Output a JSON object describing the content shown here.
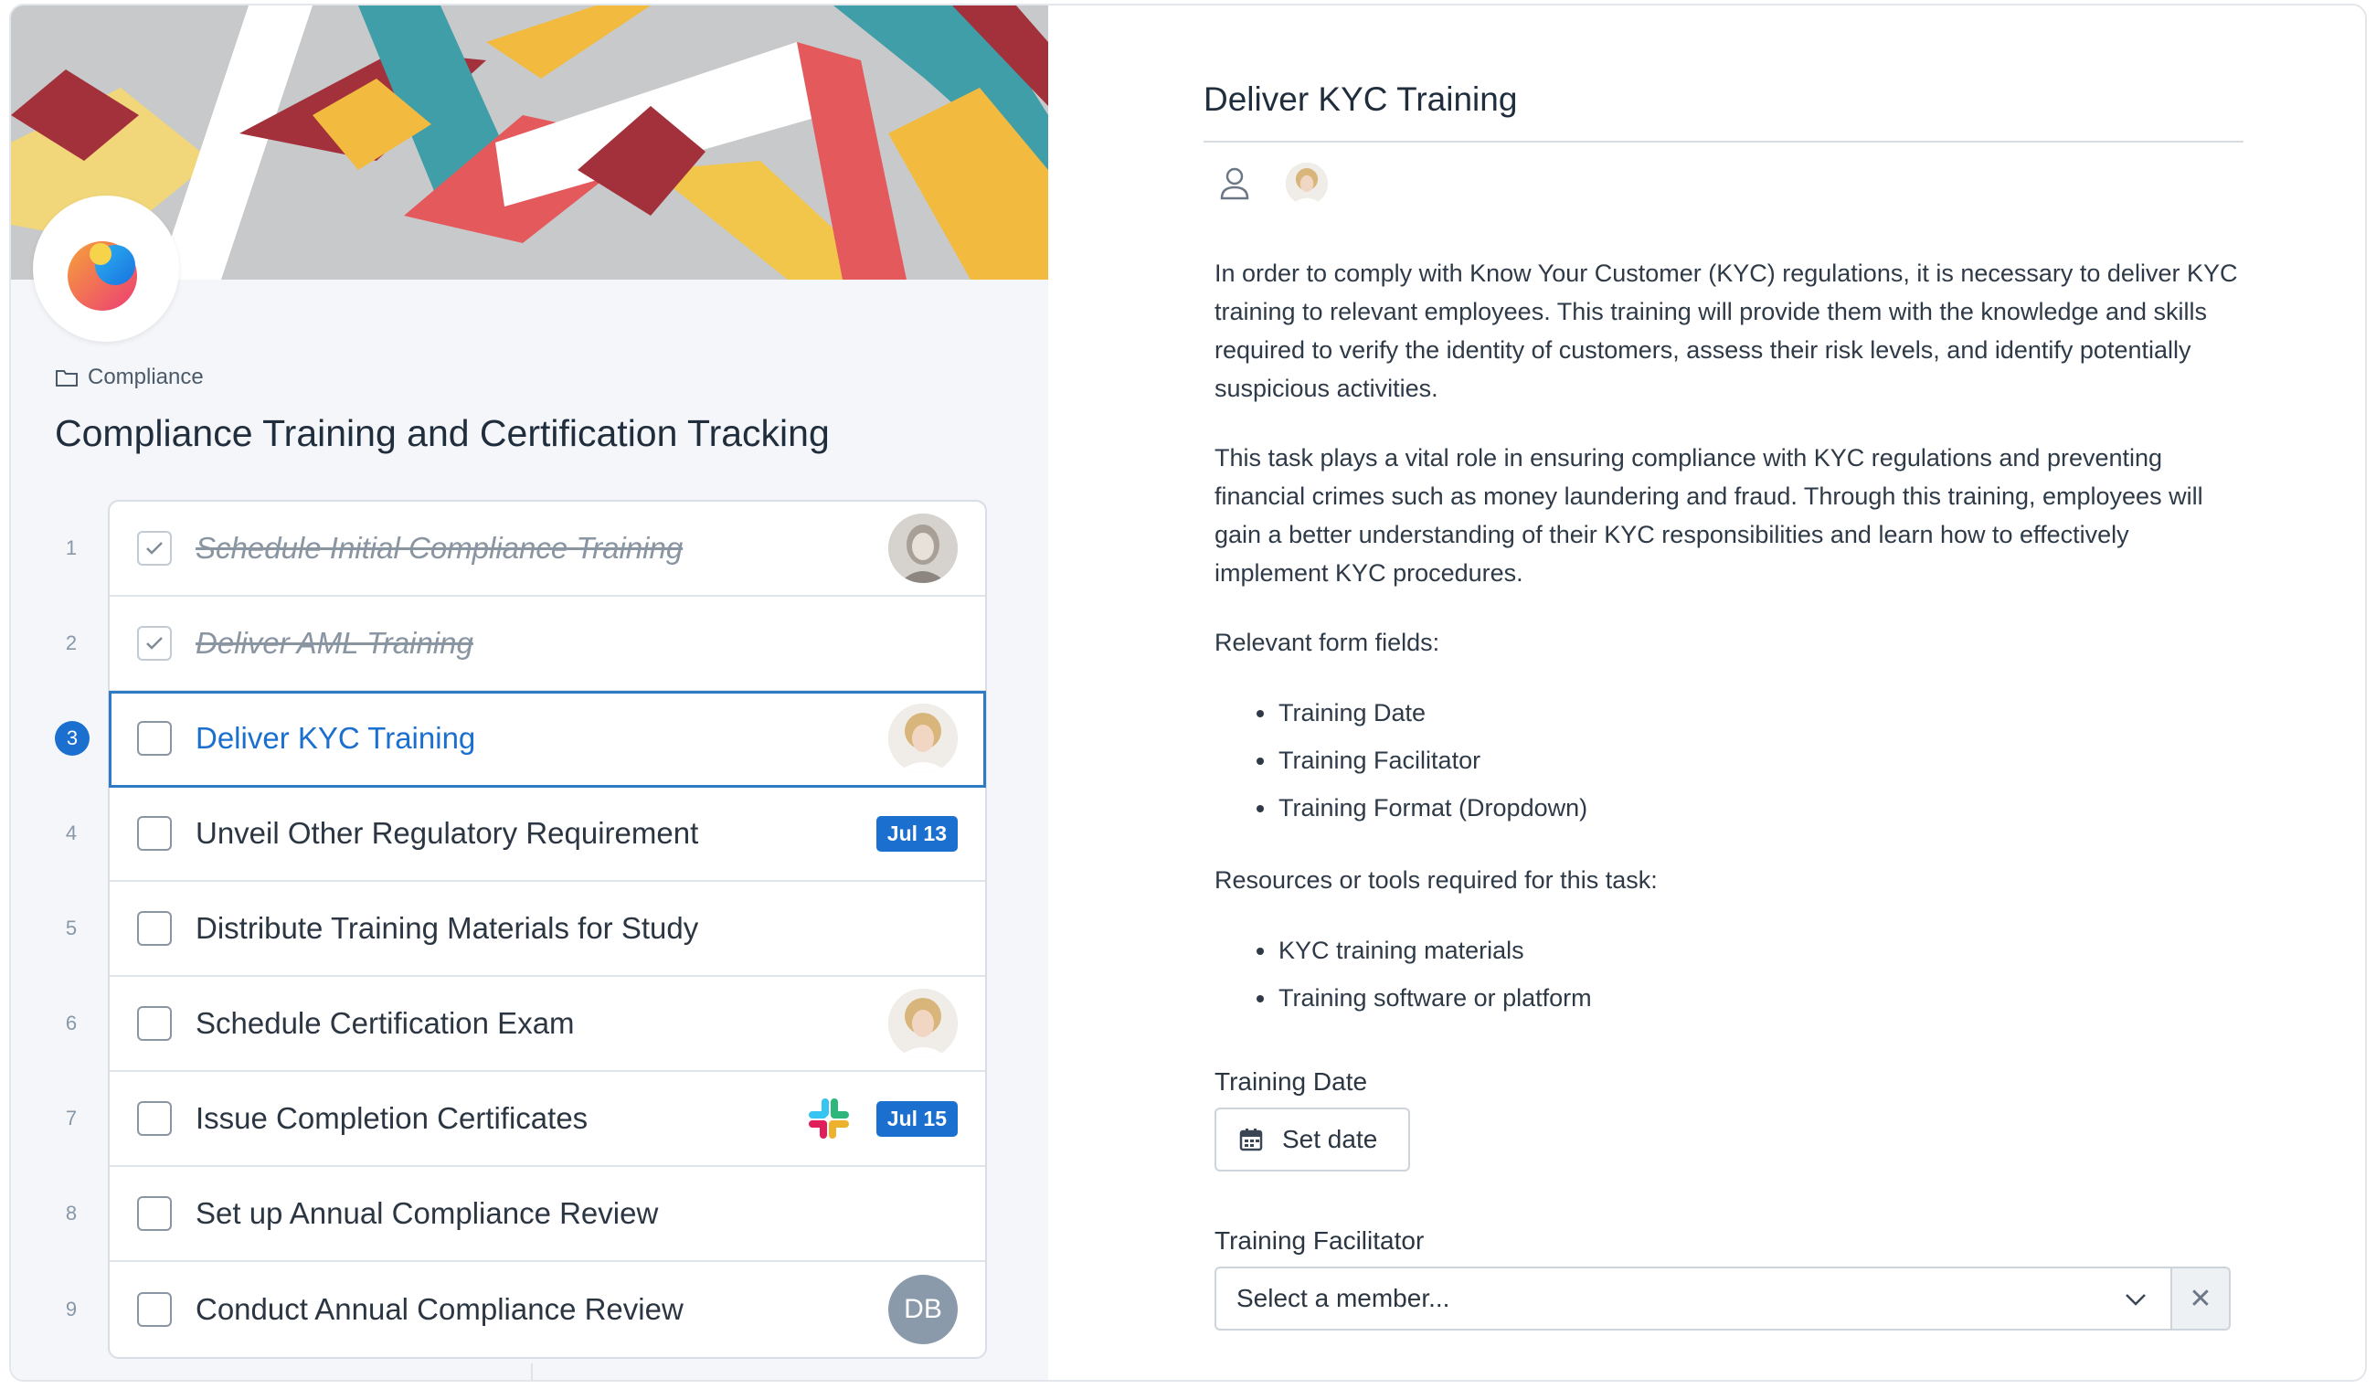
{
  "workflow": {
    "folder": "Compliance",
    "title": "Compliance Training and Certification Tracking"
  },
  "tasks": [
    {
      "num": "1",
      "label": "Schedule Initial Compliance Training",
      "done": true,
      "assignee": "avatar"
    },
    {
      "num": "2",
      "label": "Deliver AML Training",
      "done": true
    },
    {
      "num": "3",
      "label": "Deliver KYC Training",
      "done": false,
      "active": true,
      "assignee": "avatar"
    },
    {
      "num": "4",
      "label": "Unveil Other Regulatory Requirement",
      "done": false,
      "due": "Jul 13"
    },
    {
      "num": "5",
      "label": "Distribute Training Materials for Study",
      "done": false
    },
    {
      "num": "6",
      "label": "Schedule Certification Exam",
      "done": false,
      "assignee": "avatar"
    },
    {
      "num": "7",
      "label": "Issue Completion Certificates",
      "done": false,
      "integration": "slack-icon",
      "due": "Jul 15"
    },
    {
      "num": "8",
      "label": "Set up Annual Compliance Review",
      "done": false
    },
    {
      "num": "9",
      "label": "Conduct Annual Compliance Review",
      "done": false,
      "assignee_initials": "DB"
    }
  ],
  "detail": {
    "title": "Deliver KYC Training",
    "paragraphs": [
      "In order to comply with Know Your Customer (KYC) regulations, it is necessary to deliver KYC training to relevant employees. This training will provide them with the knowledge and skills required to verify the identity of customers, assess their risk levels, and identify potentially suspicious activities.",
      "This task plays a vital role in ensuring compliance with KYC regulations and preventing financial crimes such as money laundering and fraud. Through this training, employees will gain a better understanding of their KYC responsibilities and learn how to effectively implement KYC procedures.",
      "Relevant form fields:"
    ],
    "form_fields_list": [
      "Training Date",
      "Training Facilitator",
      "Training Format (Dropdown)"
    ],
    "resources_heading": "Resources or tools required for this task:",
    "resources_list": [
      "KYC training materials",
      "Training software or platform"
    ],
    "training_date_label": "Training Date",
    "set_date_label": "Set date",
    "facilitator_label": "Training Facilitator",
    "facilitator_placeholder": "Select a member...",
    "clear_symbol": "✕"
  },
  "colors": {
    "accent": "#1a6fcf",
    "left_bg": "#f4f6f9",
    "badge_bg": "#1a6fcf"
  }
}
